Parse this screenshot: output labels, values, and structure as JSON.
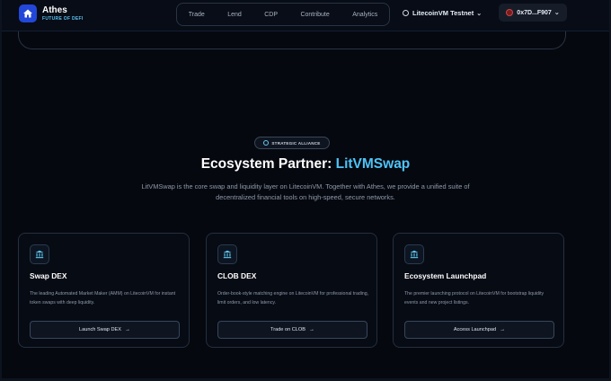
{
  "brand": {
    "name": "Athes",
    "tagline": "FUTURE OF DEFI"
  },
  "nav": {
    "items": [
      {
        "label": "Trade"
      },
      {
        "label": "Lend"
      },
      {
        "label": "CDP"
      },
      {
        "label": "Contribute"
      },
      {
        "label": "Analytics"
      }
    ]
  },
  "network": {
    "label": "LitecoinVM Testnet"
  },
  "wallet": {
    "address": "0x7D...F907"
  },
  "hero": {
    "badge": "STRATEGIC ALLIANCE",
    "title_prefix": "Ecosystem Partner: ",
    "title_highlight": "LitVMSwap",
    "description_line1": "LitVMSwap is the core swap and liquidity layer on LitecoinVM. Together with Athes, we provide a unified suite of",
    "description_line2": "decentralized financial tools on high-speed, secure networks."
  },
  "cards": [
    {
      "title": "Swap DEX",
      "description": "The leading Automated Market Maker (AMM) on LitecoinVM for instant token swaps with deep liquidity.",
      "button": "Launch Swap DEX",
      "icon": "bank-icon"
    },
    {
      "title": "CLOB DEX",
      "description": "Order-book-style matching engine on LitecoinVM for professional trading, limit orders, and low latency.",
      "button": "Trade on CLOB",
      "icon": "bank-icon"
    },
    {
      "title": "Ecosystem Launchpad",
      "description": "The premier launching protocol on LitecoinVM for bootstrap liquidity events and new project listings.",
      "button": "Access Launchpad",
      "icon": "bank-icon"
    }
  ],
  "colors": {
    "background": "#05080f",
    "accent": "#4fc3f7",
    "logo": "#2247d9"
  }
}
